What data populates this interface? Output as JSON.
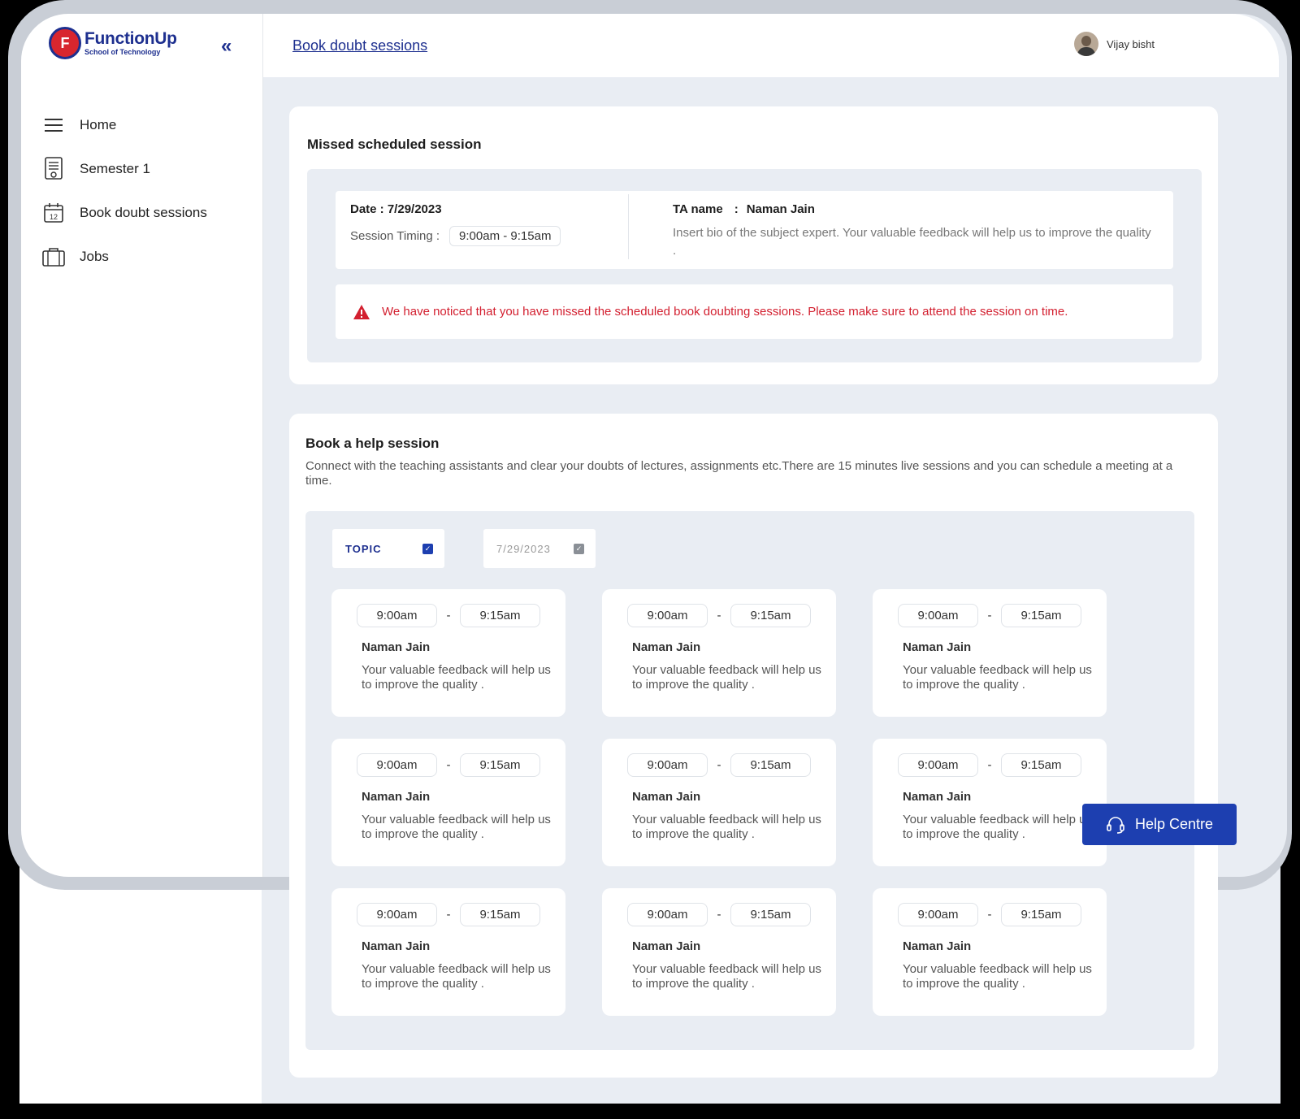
{
  "app": {
    "brand": "FunctionUp",
    "brand_sub": "School of Technology",
    "logo_letter": "F"
  },
  "sidebar": {
    "items": [
      {
        "label": "Home",
        "icon": "hamburger-icon"
      },
      {
        "label": "Semester 1",
        "icon": "document-icon"
      },
      {
        "label": "Book doubt sessions",
        "icon": "calendar-icon",
        "calendar_day": "12"
      },
      {
        "label": "Jobs",
        "icon": "briefcase-icon"
      }
    ]
  },
  "header": {
    "breadcrumb": "Book doubt sessions",
    "user_name": "Vijay bisht"
  },
  "missed": {
    "title": "Missed scheduled session",
    "date_label": "Date : 7/29/2023",
    "timing_label": "Session Timing :",
    "timing_value": "9:00am - 9:15am",
    "ta_label": "TA name",
    "ta_sep": ":",
    "ta_name": "Naman Jain",
    "bio": "Insert bio of the subject expert. Your valuable feedback will help us to improve the quality .",
    "alert": "We have noticed that you have missed the scheduled  book doubting sessions. Please make sure to attend the session on time."
  },
  "book": {
    "title": "Book a help session",
    "description": "Connect with the teaching assistants and clear your doubts of lectures, assignments etc.There are 15 minutes live sessions and you can schedule a meeting at a time.",
    "topic_filter": "TOPIC",
    "date_filter": "7/29/2023",
    "slots": [
      {
        "start": "9:00am",
        "end": "9:15am",
        "name": "Naman Jain",
        "desc": "Your valuable feedback will help us to improve the quality ."
      },
      {
        "start": "9:00am",
        "end": "9:15am",
        "name": "Naman Jain",
        "desc": "Your valuable feedback will help us to improve the quality ."
      },
      {
        "start": "9:00am",
        "end": "9:15am",
        "name": "Naman Jain",
        "desc": "Your valuable feedback will help us to improve the quality ."
      },
      {
        "start": "9:00am",
        "end": "9:15am",
        "name": "Naman Jain",
        "desc": "Your valuable feedback will help us to improve the quality ."
      },
      {
        "start": "9:00am",
        "end": "9:15am",
        "name": "Naman Jain",
        "desc": "Your valuable feedback will help us to improve the quality ."
      },
      {
        "start": "9:00am",
        "end": "9:15am",
        "name": "Naman Jain",
        "desc": "Your valuable feedback will help us to improve the quality ."
      },
      {
        "start": "9:00am",
        "end": "9:15am",
        "name": "Naman Jain",
        "desc": "Your valuable feedback will help us to improve the quality ."
      },
      {
        "start": "9:00am",
        "end": "9:15am",
        "name": "Naman Jain",
        "desc": "Your valuable feedback will help us to improve the quality ."
      },
      {
        "start": "9:00am",
        "end": "9:15am",
        "name": "Naman Jain",
        "desc": "Your valuable feedback will help us to improve the quality ."
      }
    ],
    "dash": "-"
  },
  "help": {
    "label": "Help Centre",
    "icon": "headset-icon"
  },
  "colors": {
    "brand_blue": "#1d2f8f",
    "button_blue": "#1d3fb0",
    "alert_red": "#d32030",
    "page_bg": "#e9edf3"
  }
}
